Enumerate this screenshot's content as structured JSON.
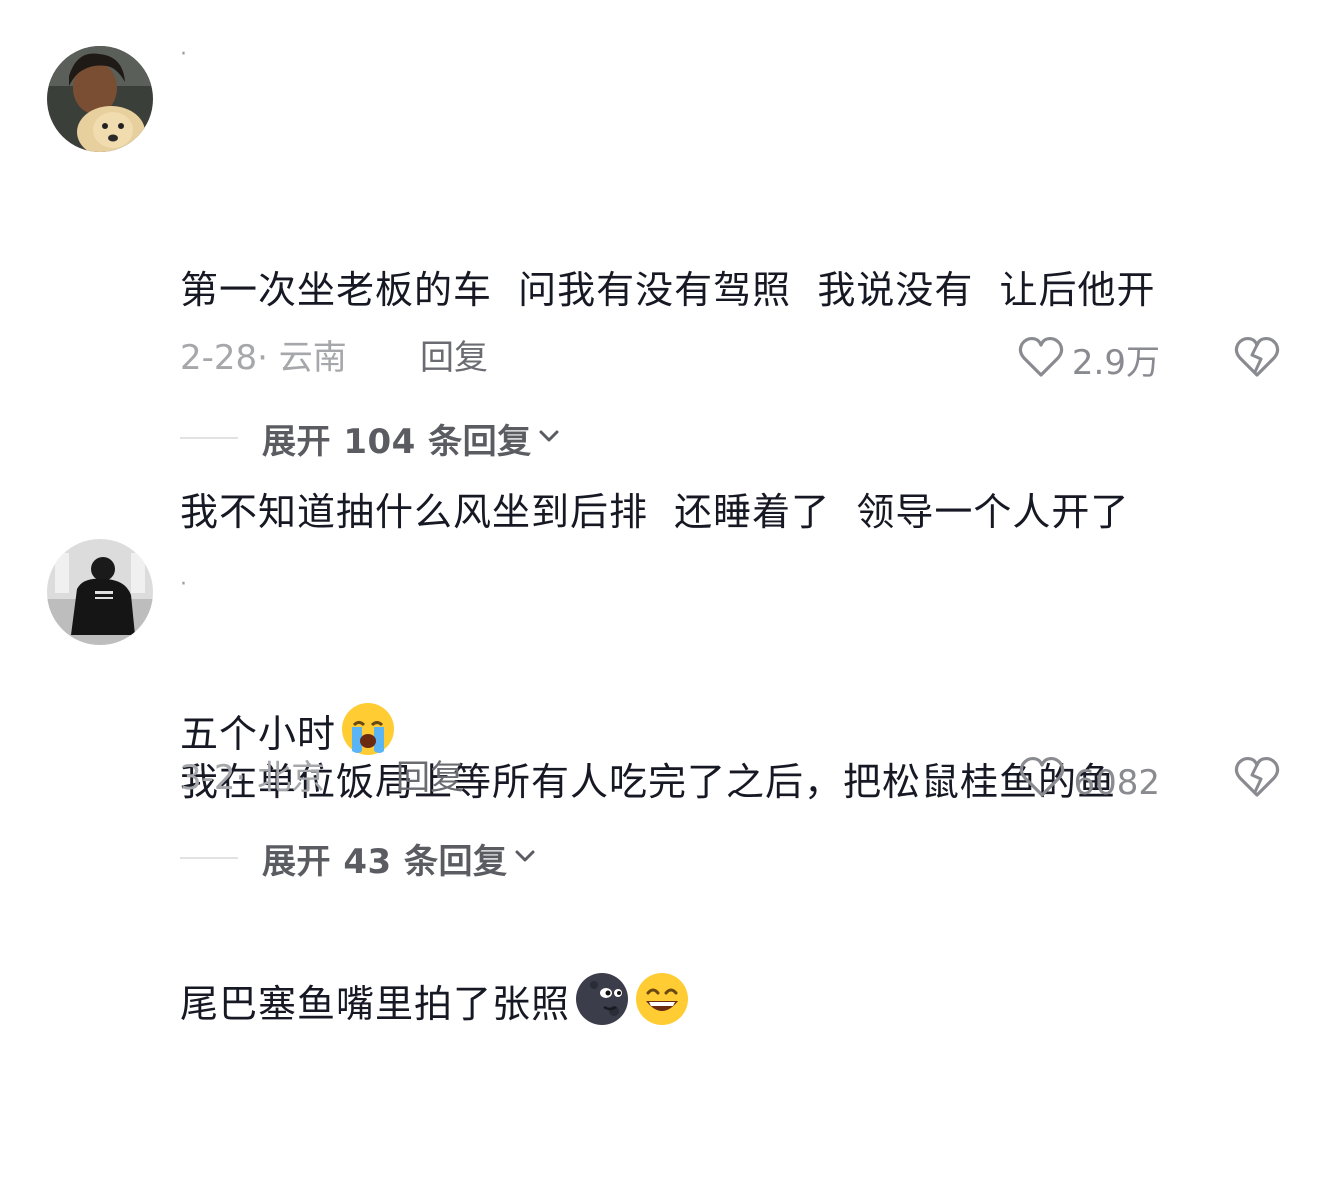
{
  "comments": [
    {
      "username": "·",
      "text_lines": [
        "第一次坐老板的车  问我有没有驾照  我说没有  让后他开",
        "我不知道抽什么风坐到后排  还睡着了  领导一个人开了",
        "五个小时"
      ],
      "emojis": [
        "loudly-crying-face"
      ],
      "time": "2-28· 云南",
      "reply_label": "回复",
      "likes": "2.9万",
      "expand_label": "展开 104 条回复"
    },
    {
      "username": "·",
      "text_lines": [
        "我在单位饭局上等所有人吃完了之后，把松鼠桂鱼的鱼",
        "尾巴塞鱼嘴里拍了张照"
      ],
      "emojis": [
        "new-moon-face",
        "grinning-squinting-face"
      ],
      "time": "3-2· 北京",
      "reply_label": "回复",
      "likes": "6082",
      "expand_label": "展开 43 条回复"
    }
  ],
  "colors": {
    "text": "#161823",
    "meta": "#a6a7ab",
    "icon": "#8a8b90"
  }
}
